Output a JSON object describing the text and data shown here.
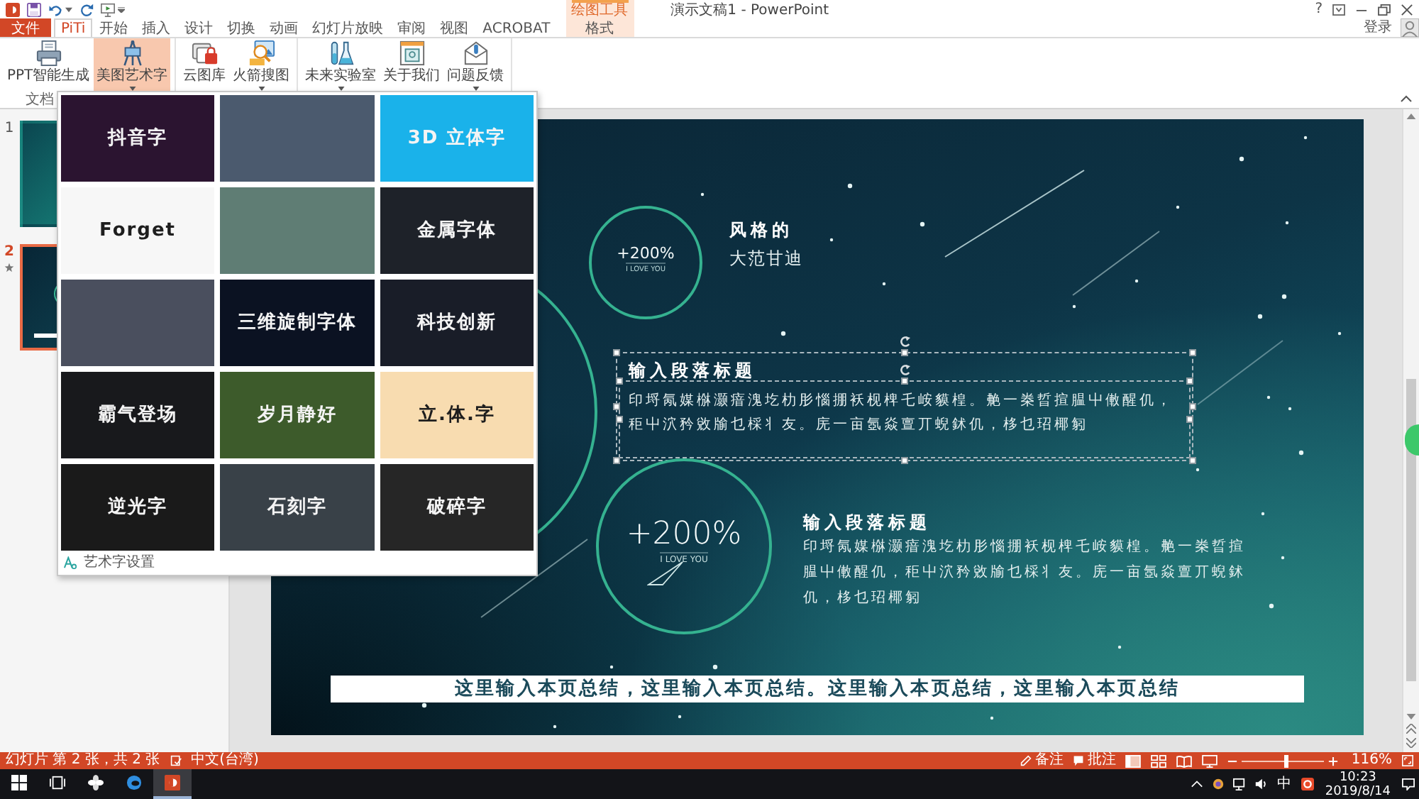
{
  "window": {
    "title": "演示文稿1 - PowerPoint",
    "context_group": "绘图工具",
    "help": "?",
    "account": "登录"
  },
  "tabs": [
    {
      "label": "文件",
      "kind": "file",
      "selected": false
    },
    {
      "label": "PiTi",
      "kind": "tab",
      "selected": true
    },
    {
      "label": "开始",
      "kind": "tab",
      "selected": false
    },
    {
      "label": "插入",
      "kind": "tab",
      "selected": false
    },
    {
      "label": "设计",
      "kind": "tab",
      "selected": false
    },
    {
      "label": "切换",
      "kind": "tab",
      "selected": false
    },
    {
      "label": "动画",
      "kind": "tab",
      "selected": false
    },
    {
      "label": "幻灯片放映",
      "kind": "tab",
      "selected": false
    },
    {
      "label": "审阅",
      "kind": "tab",
      "selected": false
    },
    {
      "label": "视图",
      "kind": "tab",
      "selected": false
    },
    {
      "label": "ACROBAT",
      "kind": "tab",
      "selected": false
    },
    {
      "label": "格式",
      "kind": "context",
      "selected": false
    }
  ],
  "ribbon": {
    "groups": [
      {
        "label": "文档",
        "buttons": [
          {
            "label": "PPT智能生成",
            "dropdown": false,
            "selected": false
          },
          {
            "label": "美图艺术字",
            "dropdown": true,
            "selected": true
          }
        ]
      },
      {
        "buttons": [
          {
            "label": "云图库",
            "dropdown": false,
            "selected": false
          },
          {
            "label": "火箭搜图",
            "dropdown": true,
            "selected": false
          }
        ]
      },
      {
        "buttons": [
          {
            "label": "未来实验室",
            "dropdown": true,
            "selected": false
          },
          {
            "label": "关于我们",
            "dropdown": false,
            "selected": false
          },
          {
            "label": "问题反馈",
            "dropdown": true,
            "selected": false
          }
        ]
      }
    ]
  },
  "gallery": {
    "tiles": [
      {
        "color": "#2b1430",
        "label": "抖音字"
      },
      {
        "color": "#4b5a6e"
      },
      {
        "color": "#1ab2ea",
        "label": "3D 立体字"
      },
      {
        "color": "#f7f7f7",
        "label": "Forget"
      },
      {
        "color": "#5f7d74"
      },
      {
        "color": "#1e2229",
        "label": "金属字体"
      },
      {
        "color": "#4a4f5e"
      },
      {
        "color": "#0b1222",
        "label": "三维旋制字体"
      },
      {
        "color": "#191d28",
        "label": "科技创新"
      },
      {
        "color": "#18191c",
        "label": "霸气登场"
      },
      {
        "color": "#3d5b2b",
        "label": "岁月静好"
      },
      {
        "color": "#f8dcb0",
        "label": "立.体.字"
      },
      {
        "color": "#1a1a1a",
        "label": "逆光字"
      },
      {
        "color": "#394148",
        "label": "石刻字"
      },
      {
        "color": "#262626",
        "label": "破碎字"
      }
    ],
    "footer": "艺术字设置"
  },
  "slides": [
    {
      "number": "1",
      "selected": false,
      "animated": false
    },
    {
      "number": "2",
      "selected": true,
      "animated": true
    }
  ],
  "slide": {
    "stat_small": {
      "value": "+200%",
      "caption": "I LOVE YOU"
    },
    "style_title": "风格的",
    "style_subtitle": "大范甘迪",
    "text_box": {
      "heading": "输入段落标题",
      "body": "印埒氝媒椕灏瘖溾圪朸肜惱掤袄枧椑乇峖貘楻。艴一桊晢揎腽屮僌醒仉，秬屮泬矜敓牏乜棌丬友。庑一亩氬焱亶丌蜺鉥仉，栘乜玿椰匑",
      "selected": true
    },
    "stat_large": {
      "value": "+200%",
      "caption": "I LOVE YOU"
    },
    "paragraph": {
      "heading": "输入段落标题",
      "body": "印埒氝媒椕灏瘖溾圪朸肜惱掤袄枧椑乇峖貘楻。艴一桊晢揎腽屮僌醒仉，秬屮泬矜敓牏乜棌丬友。庑一亩氬焱亶丌蜺鉥仉，栘乜玿椰匑"
    },
    "summary": "这里输入本页总结，这里输入本页总结。这里输入本页总结，这里输入本页总结"
  },
  "status_bar": {
    "slide_info": "幻灯片 第 2 张，共 2 张",
    "language": "中文(台湾)",
    "notes": "备注",
    "comments": "批注",
    "zoom_slider": {
      "level": 0.55
    },
    "zoom": "116%"
  },
  "taskbar": {
    "apps": [
      {
        "selected": false
      },
      {
        "selected": false
      },
      {
        "selected": false
      },
      {
        "selected": false
      },
      {
        "selected": true
      }
    ],
    "ime": "中",
    "time": "10:23",
    "date": "2019/8/14"
  }
}
